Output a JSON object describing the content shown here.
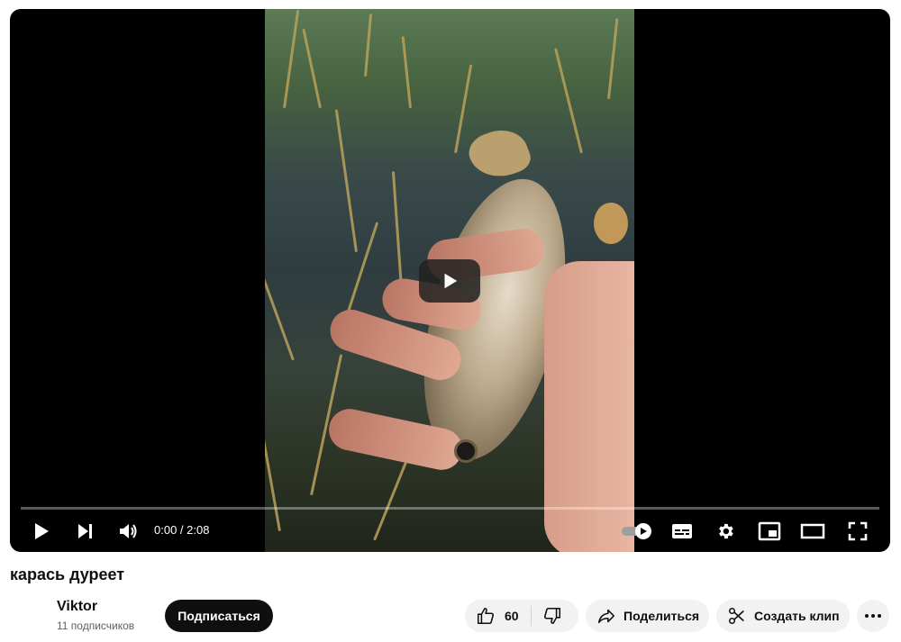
{
  "player": {
    "time_display": "0:00 / 2:08",
    "progress": 0
  },
  "video": {
    "title": "карась дуреет"
  },
  "channel": {
    "name": "Viktor",
    "subscribers": "11 подписчиков",
    "subscribe_label": "Подписаться"
  },
  "actions": {
    "like_count": "60",
    "share_label": "Поделиться",
    "clip_label": "Создать клип"
  },
  "icons": {
    "play": "play-icon",
    "next": "next-icon",
    "volume": "volume-icon",
    "autoplay": "autoplay-toggle-icon",
    "subtitles": "subtitles-icon",
    "settings": "gear-icon",
    "miniplayer": "miniplayer-icon",
    "theater": "theater-mode-icon",
    "fullscreen": "fullscreen-icon",
    "like": "thumbs-up-icon",
    "dislike": "thumbs-down-icon",
    "share": "share-icon",
    "clip": "scissors-icon",
    "more": "more-horizontal-icon"
  },
  "colors": {
    "accent": "#0f0f0f",
    "pill_bg": "#f2f2f2",
    "player_bg": "#000000"
  }
}
